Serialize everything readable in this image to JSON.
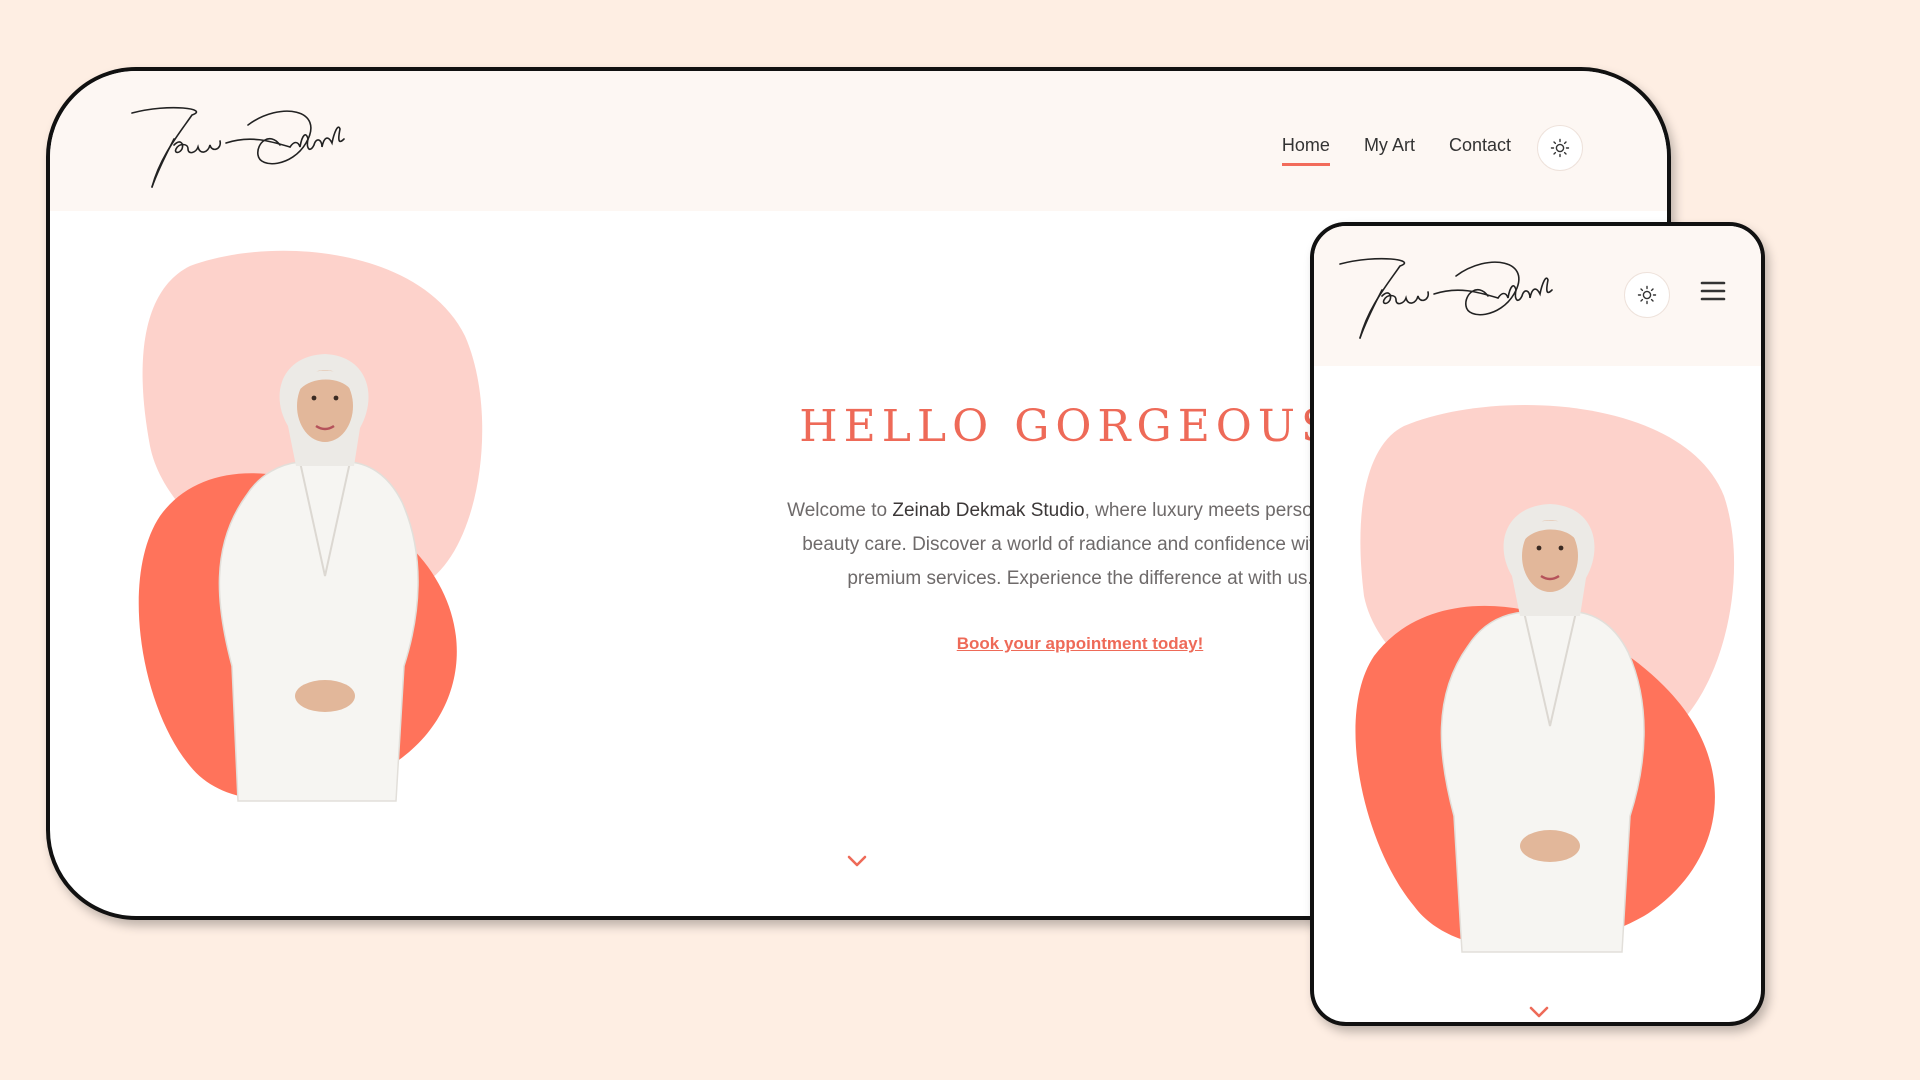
{
  "brand": {
    "logo_text": "Zeinab Dekmak"
  },
  "nav": {
    "items": [
      "Home",
      "My Art",
      "Contact"
    ],
    "active": "Home"
  },
  "hero": {
    "title": "HELLO GORGEOUS!",
    "intro_before": "Welcome to ",
    "studio_name": "Zeinab Dekmak Studio",
    "intro_after": ", where luxury meets personalized beauty care. Discover a world of radiance and confidence with our premium services. Experience the difference at with us.",
    "cta": "Book your appointment today!"
  },
  "icons": {
    "theme_toggle": "sun-icon",
    "scroll_down": "chevron-down-icon",
    "menu": "hamburger-menu-icon"
  },
  "colors": {
    "page_bg": "#feeee3",
    "header_bg": "#fdf7f3",
    "accent": "#ee6a58",
    "blob_light": "#fdd2cb",
    "blob_dark": "#ff735b"
  }
}
